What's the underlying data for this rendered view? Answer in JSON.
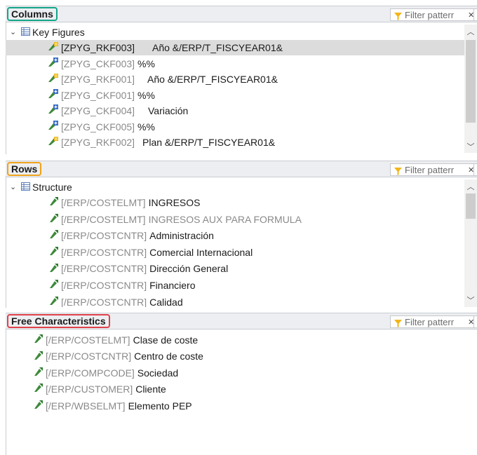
{
  "filter_placeholder": "Filter patterr",
  "colors": {
    "columns_highlight": "#13a58a",
    "rows_highlight": "#f0a21a",
    "free_highlight": "#e0414a",
    "selected_row": "#dcdcdc"
  },
  "columns": {
    "title": "Columns",
    "root_label": "Key Figures",
    "items": [
      {
        "id": "[ZPYG_RKF003]",
        "text": "Año &/ERP/T_FISCYEAR01&",
        "icon": "restricted-key-figure-icon",
        "selected": true
      },
      {
        "id": "[ZPYG_CKF003]",
        "text": "%%",
        "icon": "calculated-key-figure-icon"
      },
      {
        "id": "[ZPYG_RKF001]",
        "text": "Año &/ERP/T_FISCYEAR01&",
        "icon": "restricted-key-figure-icon"
      },
      {
        "id": "[ZPYG_CKF001]",
        "text": "%%",
        "icon": "calculated-key-figure-icon"
      },
      {
        "id": "[ZPYG_CKF004]",
        "text": "Variación",
        "icon": "calculated-key-figure-icon"
      },
      {
        "id": "[ZPYG_CKF005]",
        "text": "%%",
        "icon": "calculated-key-figure-icon"
      },
      {
        "id": "[ZPYG_RKF002]",
        "text": "Plan &/ERP/T_FISCYEAR01&",
        "icon": "restricted-key-figure-icon"
      }
    ]
  },
  "rows": {
    "title": "Rows",
    "root_label": "Structure",
    "items": [
      {
        "id": "[/ERP/COSTELMT]",
        "text": "INGRESOS"
      },
      {
        "id": "[/ERP/COSTELMT]",
        "text": "INGRESOS AUX PARA FORMULA",
        "dimmed": true
      },
      {
        "id": "[/ERP/COSTCNTR]",
        "text": "Administración"
      },
      {
        "id": "[/ERP/COSTCNTR]",
        "text": "Comercial Internacional"
      },
      {
        "id": "[/ERP/COSTCNTR]",
        "text": "Dirección General"
      },
      {
        "id": "[/ERP/COSTCNTR]",
        "text": "Financiero"
      },
      {
        "id": "[/ERP/COSTCNTR]",
        "text": "Calidad"
      }
    ]
  },
  "free": {
    "title": "Free Characteristics",
    "items": [
      {
        "id": "[/ERP/COSTELMT]",
        "text": "Clase de coste"
      },
      {
        "id": "[/ERP/COSTCNTR]",
        "text": "Centro de coste"
      },
      {
        "id": "[/ERP/COMPCODE]",
        "text": "Sociedad"
      },
      {
        "id": "[/ERP/CUSTOMER]",
        "text": "Cliente"
      },
      {
        "id": "[/ERP/WBSELMT]",
        "text": "Elemento PEP"
      }
    ]
  }
}
